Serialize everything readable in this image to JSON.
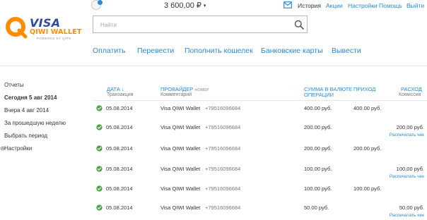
{
  "brand": {
    "visa": "VISA",
    "qiwi": "QIWI WALLET",
    "powered": "POWERED BY QIPS"
  },
  "header": {
    "balance": "3 600,00 ₽",
    "caret": "▾",
    "nav": [
      "История",
      "Акции",
      "Настройки",
      "Помощь",
      "Выйти"
    ]
  },
  "search": {
    "placeholder": "Найти"
  },
  "actions": [
    "Оплатить",
    "Перевести",
    "Пополнить кошелек",
    "Банковские карты",
    "Вывести"
  ],
  "sidebar": {
    "title": "Отчеты",
    "items": [
      "Сегодня 5 авг 2014",
      "Вчера 4 авг 2014",
      "За прошедшую неделю",
      "Выбрать период"
    ],
    "settings": "Настройки"
  },
  "table": {
    "headers": {
      "date": "ДАТА ↓",
      "date_sub": "Транзакция",
      "provider": "ПРОВАЙДЕР",
      "provider_small": "НОМЕР",
      "provider_sub": "Комментарий",
      "amount_1": "СУММА В ВАЛЮТЕ",
      "amount_2": "ОПЕРАЦИИ",
      "income": "ПРИХОД",
      "expense": "РАСХОД",
      "expense_sub": "Комиссия"
    },
    "rows": [
      {
        "date": "05.08.2014",
        "provider": "Visa QIWI Wallet",
        "number": "+79516096684",
        "amount": "400.00 руб.",
        "income": "400.00 руб.",
        "expense": "",
        "print": ""
      },
      {
        "date": "05.08.2014",
        "provider": "Visa QIWI Wallet",
        "number": "+79516096684",
        "amount": "200.00 руб.",
        "income": "",
        "expense": "200,00 руб.",
        "print": "Распечатать чек"
      },
      {
        "date": "05.08.2014",
        "provider": "Visa QIWI Wallet",
        "number": "+79516096684",
        "amount": "200.00 руб.",
        "income": "200.00 руб.",
        "expense": "",
        "print": ""
      },
      {
        "date": "05.08.2014",
        "provider": "Visa QIWI Wallet",
        "number": "+79516096684",
        "amount": "100.00 руб.",
        "income": "",
        "expense": "100,00 руб.",
        "print": "Распечатать чек"
      },
      {
        "date": "05.08.2014",
        "provider": "Visa QIWI Wallet",
        "number": "+79516096684",
        "amount": "100.00 руб.",
        "income": "100.00 руб.",
        "expense": "",
        "print": ""
      },
      {
        "date": "05.08.2014",
        "provider": "Visa QIWI Wallet",
        "number": "+79516096684",
        "amount": "50.00 руб.",
        "income": "",
        "expense": "50,00 руб.",
        "print": "Распечатать чек"
      }
    ]
  },
  "colors": {
    "link": "#2b8ad6",
    "visa_blue": "#2c4c9c",
    "qiwi_orange": "#ff8c00",
    "ok_green": "#48a23f"
  },
  "icons": {
    "mail": "mail-icon",
    "search": "search-icon",
    "gear": "gear-icon",
    "status": "checkmark-circle-icon"
  }
}
